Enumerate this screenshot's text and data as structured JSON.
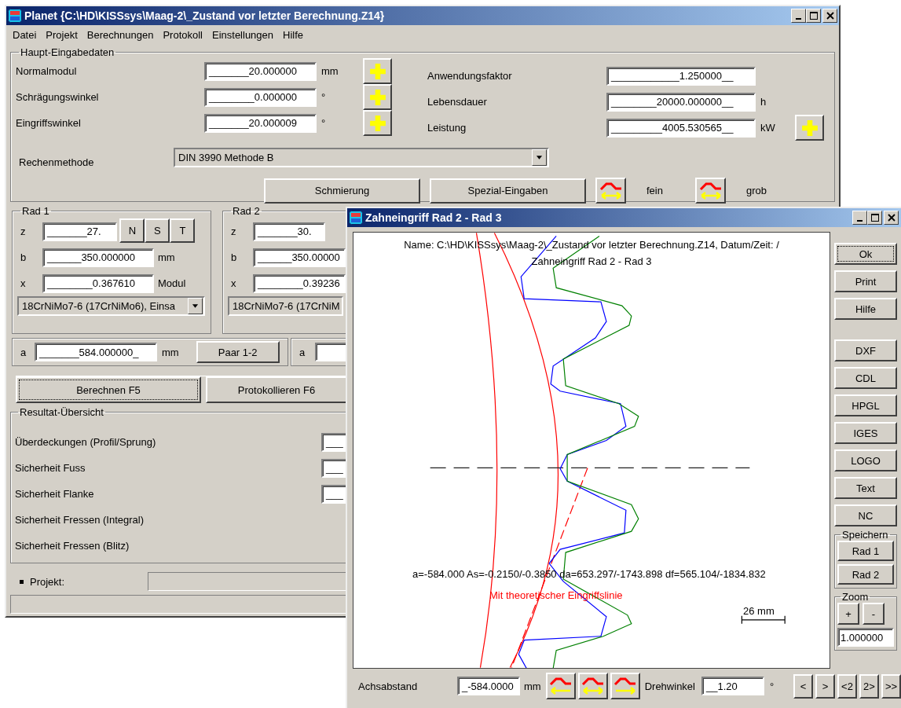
{
  "main_window": {
    "title": "Planet {C:\\HD\\KISSsys\\Maag-2\\_Zustand vor letzter Berechnung.Z14}",
    "menu": [
      "Datei",
      "Projekt",
      "Berechnungen",
      "Protokoll",
      "Einstellungen",
      "Hilfe"
    ],
    "main_input": {
      "legend": "Haupt-Eingabedaten",
      "left_fields": [
        {
          "label": "Normalmodul",
          "value": "_______20.000000",
          "unit": "mm"
        },
        {
          "label": "Schrägungswinkel",
          "value": "________0.000000",
          "unit": "°"
        },
        {
          "label": "Eingriffswinkel",
          "value": "_______20.000009",
          "unit": "°"
        }
      ],
      "right_fields": [
        {
          "label": "Anwendungsfaktor",
          "value": "____________1.250000__"
        },
        {
          "label": "Lebensdauer",
          "value": "________20000.000000__",
          "unit": "h"
        },
        {
          "label": "Leistung",
          "value": "_________4005.530565__",
          "unit": "kW"
        }
      ],
      "method": {
        "label": "Rechenmethode",
        "value": "DIN 3990 Methode B"
      },
      "buttons": [
        "Schmierung",
        "Spezial-Eingaben"
      ],
      "step_buttons": [
        {
          "label": "fein"
        },
        {
          "label": "grob"
        }
      ]
    },
    "gears": [
      {
        "legend": "Rad 1",
        "fields": [
          {
            "label": "z",
            "value": "_______27."
          },
          {
            "label": "b",
            "value": "______350.000000",
            "unit": "mm"
          },
          {
            "label": "x",
            "value": "________0.367610",
            "unit": "Modul"
          }
        ],
        "buttons": [
          "N",
          "S",
          "T"
        ],
        "material": "18CrNiMo7-6 (17CrNiMo6), Einsa"
      },
      {
        "legend": "Rad 2",
        "fields": [
          {
            "label": "z",
            "value": "_______30."
          },
          {
            "label": "b",
            "value": "______350.00000"
          },
          {
            "label": "x",
            "value": "________0.39236"
          }
        ],
        "material": "18CrNiMo7-6 (17CrNiM"
      }
    ],
    "pairs": [
      {
        "label": "a",
        "value": "_______584.000000_",
        "unit": "mm",
        "button": "Paar 1-2"
      },
      {
        "label": "a"
      }
    ],
    "actions": [
      {
        "label": "Berechnen F5",
        "focused": true
      },
      {
        "label": "Protokollieren F6",
        "focused": false
      }
    ],
    "results": {
      "legend": "Resultat-Übersicht",
      "rows": [
        {
          "label": "Überdeckungen (Profil/Sprung)",
          "value": "___"
        },
        {
          "label": "Sicherheit Fuss",
          "value": "___"
        },
        {
          "label": "Sicherheit Flanke",
          "value": "___"
        },
        {
          "label": "Sicherheit Fressen (Integral)"
        },
        {
          "label": "Sicherheit Fressen (Blitz)"
        }
      ]
    },
    "project_label": "Projekt:"
  },
  "dialog": {
    "title": "Zahneingriff Rad 2 - Rad 3",
    "canvas": {
      "name_line": "Name:  C:\\HD\\KISSsys\\Maag-2\\_Zustand vor letzter Berechnung.Z14, Datum/Zeit: /",
      "heading": "Zahneingriff Rad 2 - Rad 3",
      "dimensions": "a=-584.000 As=-0.2150/-0.3850 da=653.297/-1743.898 df=565.104/-1834.832",
      "note": "Mit theoretischer Eingriffslinie",
      "scale": "26 mm"
    },
    "buttons": [
      {
        "label": "Ok",
        "focused": true
      },
      {
        "label": "Print",
        "focused": false
      },
      {
        "label": "Hilfe",
        "focused": false
      }
    ],
    "export_buttons": [
      "DXF",
      "CDL",
      "HPGL",
      "IGES",
      "LOGO",
      "Text",
      "NC"
    ],
    "save_group": {
      "legend": "Speichern",
      "buttons": [
        "Rad 1",
        "Rad 2"
      ]
    },
    "zoom": {
      "legend": "Zoom",
      "buttons": [
        "+",
        "-"
      ],
      "value": "1.000000"
    },
    "bottom": {
      "axis_label": "Achsabstand",
      "axis_value": "_-584.0000",
      "axis_unit": "mm",
      "shift_buttons": [
        {
          "kind": "left"
        },
        {
          "kind": "both"
        },
        {
          "kind": "right"
        }
      ],
      "angle_label": "Drehwinkel",
      "angle_value": "__1.20",
      "angle_unit": "°",
      "nav_buttons": [
        "<",
        ">",
        "<2",
        "2>",
        ">>"
      ]
    }
  }
}
